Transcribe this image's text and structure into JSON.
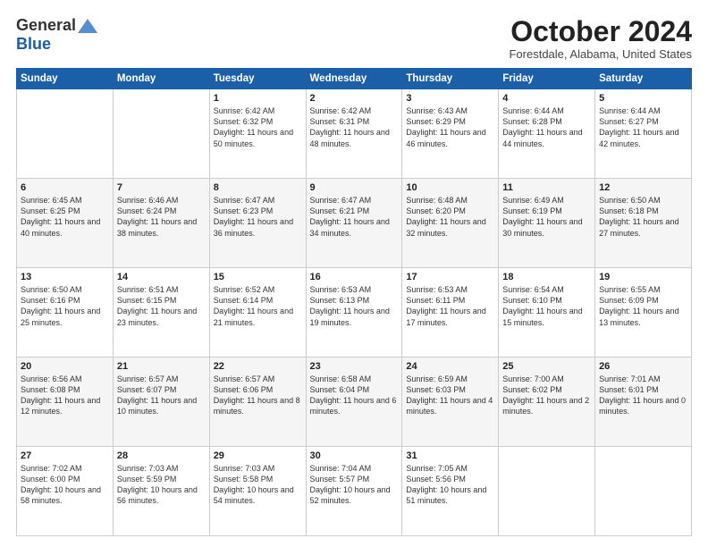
{
  "header": {
    "logo_general": "General",
    "logo_blue": "Blue",
    "month_title": "October 2024",
    "location": "Forestdale, Alabama, United States"
  },
  "weekdays": [
    "Sunday",
    "Monday",
    "Tuesday",
    "Wednesday",
    "Thursday",
    "Friday",
    "Saturday"
  ],
  "weeks": [
    [
      {
        "day": "",
        "text": ""
      },
      {
        "day": "",
        "text": ""
      },
      {
        "day": "1",
        "text": "Sunrise: 6:42 AM\nSunset: 6:32 PM\nDaylight: 11 hours and 50 minutes."
      },
      {
        "day": "2",
        "text": "Sunrise: 6:42 AM\nSunset: 6:31 PM\nDaylight: 11 hours and 48 minutes."
      },
      {
        "day": "3",
        "text": "Sunrise: 6:43 AM\nSunset: 6:29 PM\nDaylight: 11 hours and 46 minutes."
      },
      {
        "day": "4",
        "text": "Sunrise: 6:44 AM\nSunset: 6:28 PM\nDaylight: 11 hours and 44 minutes."
      },
      {
        "day": "5",
        "text": "Sunrise: 6:44 AM\nSunset: 6:27 PM\nDaylight: 11 hours and 42 minutes."
      }
    ],
    [
      {
        "day": "6",
        "text": "Sunrise: 6:45 AM\nSunset: 6:25 PM\nDaylight: 11 hours and 40 minutes."
      },
      {
        "day": "7",
        "text": "Sunrise: 6:46 AM\nSunset: 6:24 PM\nDaylight: 11 hours and 38 minutes."
      },
      {
        "day": "8",
        "text": "Sunrise: 6:47 AM\nSunset: 6:23 PM\nDaylight: 11 hours and 36 minutes."
      },
      {
        "day": "9",
        "text": "Sunrise: 6:47 AM\nSunset: 6:21 PM\nDaylight: 11 hours and 34 minutes."
      },
      {
        "day": "10",
        "text": "Sunrise: 6:48 AM\nSunset: 6:20 PM\nDaylight: 11 hours and 32 minutes."
      },
      {
        "day": "11",
        "text": "Sunrise: 6:49 AM\nSunset: 6:19 PM\nDaylight: 11 hours and 30 minutes."
      },
      {
        "day": "12",
        "text": "Sunrise: 6:50 AM\nSunset: 6:18 PM\nDaylight: 11 hours and 27 minutes."
      }
    ],
    [
      {
        "day": "13",
        "text": "Sunrise: 6:50 AM\nSunset: 6:16 PM\nDaylight: 11 hours and 25 minutes."
      },
      {
        "day": "14",
        "text": "Sunrise: 6:51 AM\nSunset: 6:15 PM\nDaylight: 11 hours and 23 minutes."
      },
      {
        "day": "15",
        "text": "Sunrise: 6:52 AM\nSunset: 6:14 PM\nDaylight: 11 hours and 21 minutes."
      },
      {
        "day": "16",
        "text": "Sunrise: 6:53 AM\nSunset: 6:13 PM\nDaylight: 11 hours and 19 minutes."
      },
      {
        "day": "17",
        "text": "Sunrise: 6:53 AM\nSunset: 6:11 PM\nDaylight: 11 hours and 17 minutes."
      },
      {
        "day": "18",
        "text": "Sunrise: 6:54 AM\nSunset: 6:10 PM\nDaylight: 11 hours and 15 minutes."
      },
      {
        "day": "19",
        "text": "Sunrise: 6:55 AM\nSunset: 6:09 PM\nDaylight: 11 hours and 13 minutes."
      }
    ],
    [
      {
        "day": "20",
        "text": "Sunrise: 6:56 AM\nSunset: 6:08 PM\nDaylight: 11 hours and 12 minutes."
      },
      {
        "day": "21",
        "text": "Sunrise: 6:57 AM\nSunset: 6:07 PM\nDaylight: 11 hours and 10 minutes."
      },
      {
        "day": "22",
        "text": "Sunrise: 6:57 AM\nSunset: 6:06 PM\nDaylight: 11 hours and 8 minutes."
      },
      {
        "day": "23",
        "text": "Sunrise: 6:58 AM\nSunset: 6:04 PM\nDaylight: 11 hours and 6 minutes."
      },
      {
        "day": "24",
        "text": "Sunrise: 6:59 AM\nSunset: 6:03 PM\nDaylight: 11 hours and 4 minutes."
      },
      {
        "day": "25",
        "text": "Sunrise: 7:00 AM\nSunset: 6:02 PM\nDaylight: 11 hours and 2 minutes."
      },
      {
        "day": "26",
        "text": "Sunrise: 7:01 AM\nSunset: 6:01 PM\nDaylight: 11 hours and 0 minutes."
      }
    ],
    [
      {
        "day": "27",
        "text": "Sunrise: 7:02 AM\nSunset: 6:00 PM\nDaylight: 10 hours and 58 minutes."
      },
      {
        "day": "28",
        "text": "Sunrise: 7:03 AM\nSunset: 5:59 PM\nDaylight: 10 hours and 56 minutes."
      },
      {
        "day": "29",
        "text": "Sunrise: 7:03 AM\nSunset: 5:58 PM\nDaylight: 10 hours and 54 minutes."
      },
      {
        "day": "30",
        "text": "Sunrise: 7:04 AM\nSunset: 5:57 PM\nDaylight: 10 hours and 52 minutes."
      },
      {
        "day": "31",
        "text": "Sunrise: 7:05 AM\nSunset: 5:56 PM\nDaylight: 10 hours and 51 minutes."
      },
      {
        "day": "",
        "text": ""
      },
      {
        "day": "",
        "text": ""
      }
    ]
  ]
}
